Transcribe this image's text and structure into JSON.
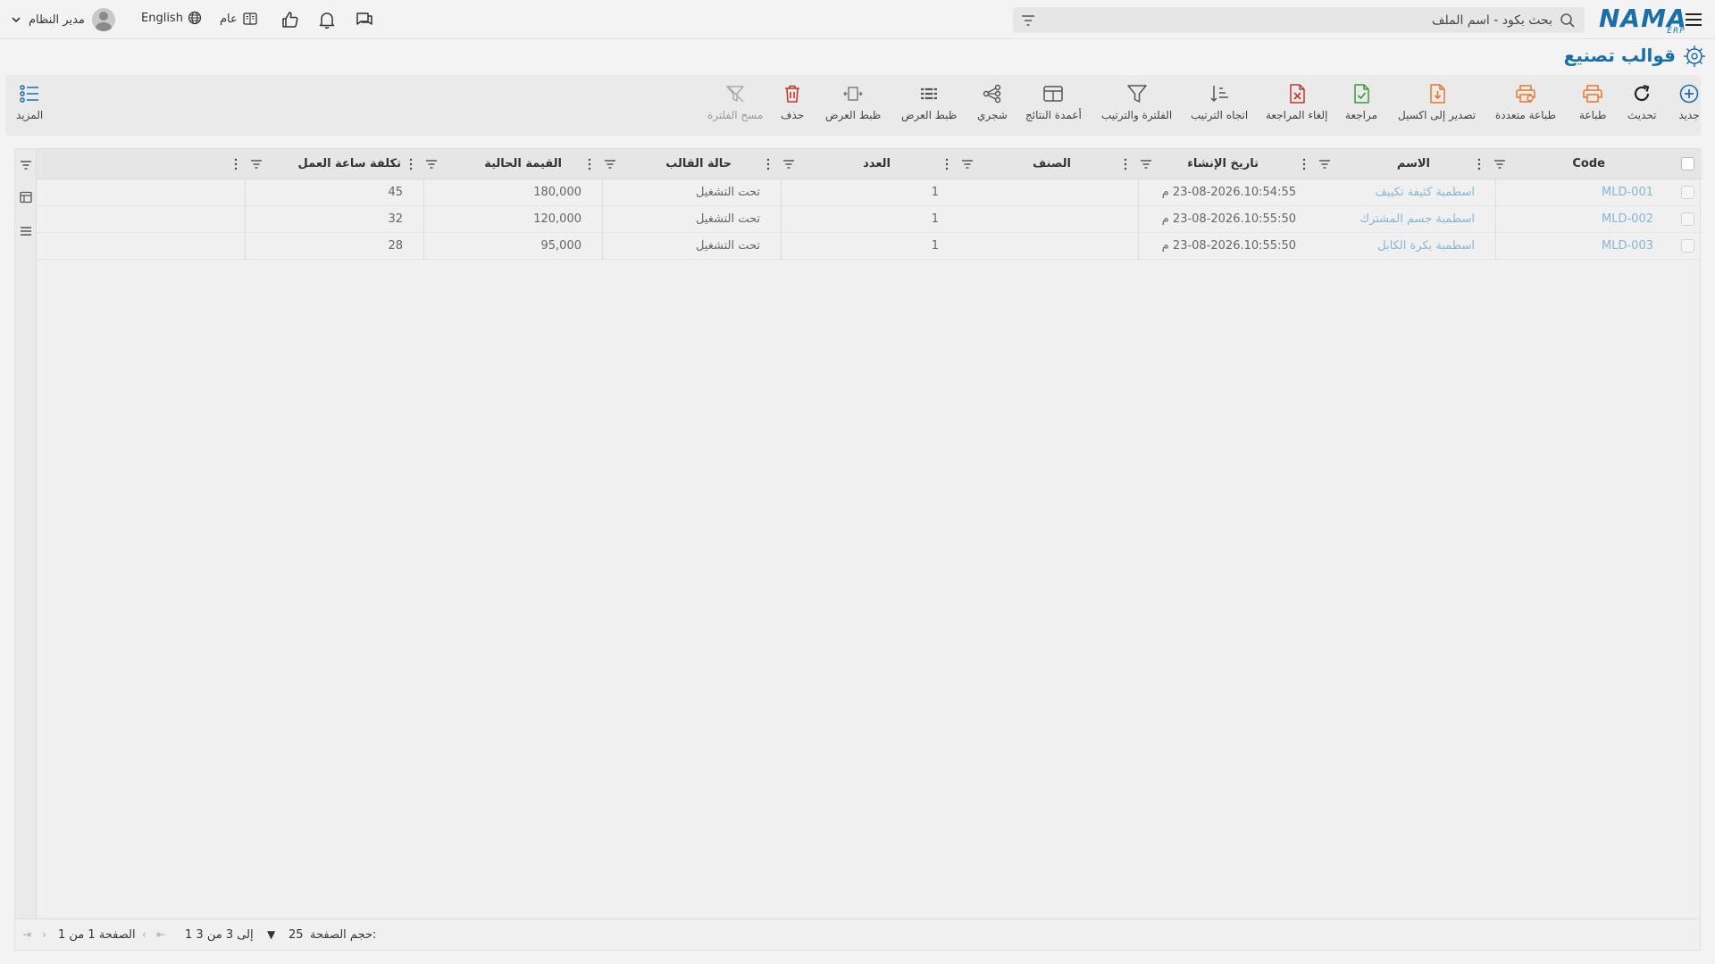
{
  "header": {
    "user_name": "مدير النظام",
    "language": "English",
    "year": "عام",
    "search_placeholder": "بحث بكود - اسم الملف",
    "logo_text": "NAMA",
    "logo_sub": "ERP"
  },
  "page": {
    "title": "قوالب تصنيع"
  },
  "toolbar": {
    "new": "جديد",
    "refresh": "تحديث",
    "print": "طباعة",
    "multi_print": "طباعة متعددة",
    "export_excel": "تصدير إلى اكسيل",
    "review": "مراجعة",
    "cancel_review": "إلغاء المراجعة",
    "sort_direction": "اتجاه الترتيب",
    "filter_sort": "الفلترة والترتيب",
    "result_columns": "أعمدة النتائج",
    "tree": "شجري",
    "fit_width_1": "ظبط العرض",
    "fit_width_2": "ظبط العرض",
    "delete": "حذف",
    "clear_filter": "مسح الفلترة",
    "more": "المزيد"
  },
  "table": {
    "columns": {
      "code": "Code",
      "name": "الاسم",
      "created": "تاريخ الإنشاء",
      "category": "الصنف",
      "count": "العدد",
      "status": "حالة القالب",
      "current_value": "القيمة الحالية",
      "labor_cost": "تكلفة ساعة العمل"
    },
    "rows": [
      {
        "code": "MLD-001",
        "name": "اسطمبة كثيفة تكييف",
        "created": "23-08-2026.10:54:55 م",
        "category": "",
        "count": "1",
        "status": "تحت التشغيل",
        "current_value": "180,000",
        "labor_cost": "45"
      },
      {
        "code": "MLD-002",
        "name": "اسطمبة جسم المشترك",
        "created": "23-08-2026.10:55:50 م",
        "category": "",
        "count": "1",
        "status": "تحت التشغيل",
        "current_value": "120,000",
        "labor_cost": "32"
      },
      {
        "code": "MLD-003",
        "name": "اسطمبة بكرة الكابل",
        "created": "23-08-2026.10:55:50 م",
        "category": "",
        "count": "1",
        "status": "تحت التشغيل",
        "current_value": "95,000",
        "labor_cost": "28"
      }
    ]
  },
  "footer": {
    "page_size_label": "حجم الصفحة:",
    "page_size": "25",
    "range_text": "1 إلى 3 من 3",
    "page_text": "الصفحة 1 من 1"
  },
  "colors": {
    "brand": "#1b6fa8",
    "link": "#86b6d6",
    "orange": "#e8742c",
    "green": "#3a9a3a",
    "red": "#c0392b"
  },
  "icons": {
    "toolbar": [
      "plus-circle-icon",
      "refresh-icon",
      "printer-icon",
      "multi-printer-icon",
      "excel-export-icon",
      "review-check-icon",
      "cancel-review-icon",
      "sort-direction-icon",
      "filter-icon",
      "columns-icon",
      "tree-icon",
      "fit-width-icon",
      "fit-width-alt-icon",
      "trash-icon",
      "clear-filter-icon",
      "list-more-icon"
    ]
  }
}
